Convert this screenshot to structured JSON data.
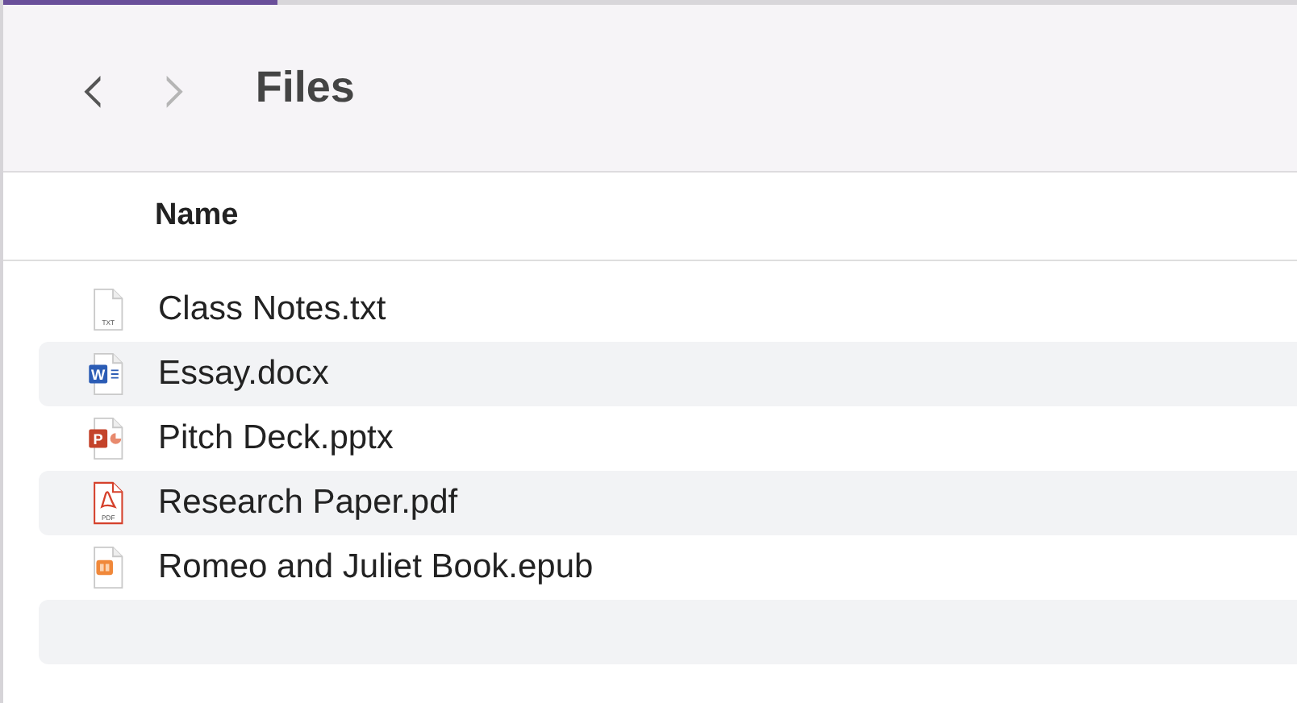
{
  "toolbar": {
    "back": "‹",
    "forward": "›",
    "title": "Files",
    "back_disabled": false,
    "forward_disabled": true
  },
  "table": {
    "columns": [
      "Name"
    ],
    "rows": [
      {
        "name": "Class Notes.txt",
        "kind": "txt",
        "icon_label": "TXT"
      },
      {
        "name": "Essay.docx",
        "kind": "docx",
        "icon_label": "W"
      },
      {
        "name": "Pitch Deck.pptx",
        "kind": "pptx",
        "icon_label": "P"
      },
      {
        "name": "Research Paper.pdf",
        "kind": "pdf",
        "icon_label": "PDF"
      },
      {
        "name": "Romeo and Juliet Book.epub",
        "kind": "epub"
      }
    ]
  }
}
